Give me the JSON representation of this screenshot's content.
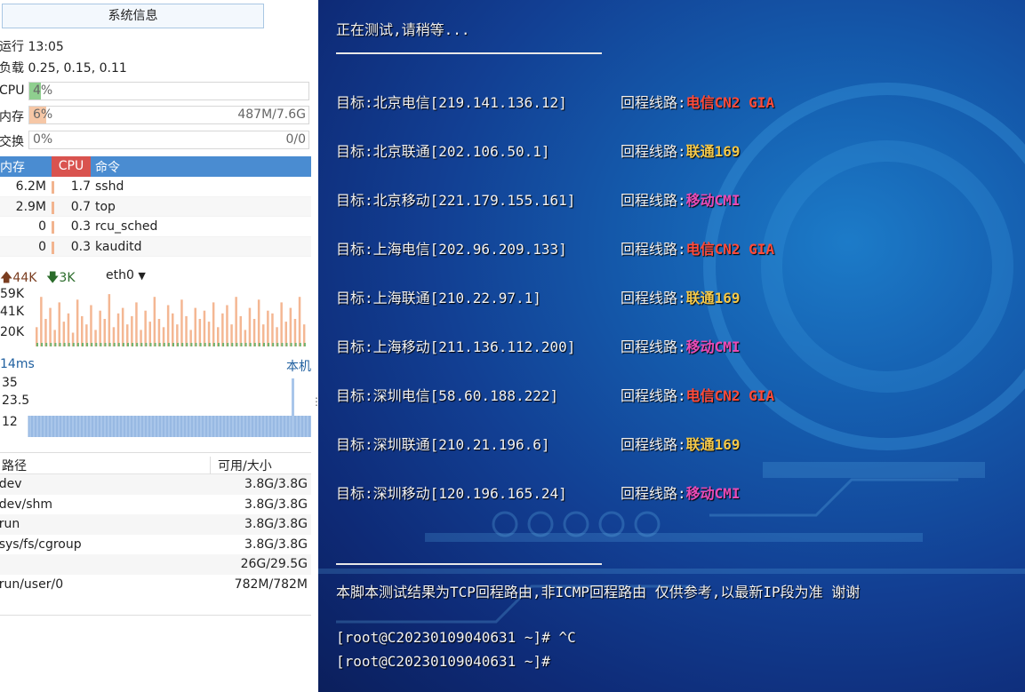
{
  "sysinfo": {
    "title_button": "系统信息",
    "uptime": "运行 13:05",
    "load": "负载 0.25, 0.15, 0.11",
    "cpu": {
      "label": "CPU",
      "percent_text": "4%",
      "value": 4,
      "color": "#8fcf8f"
    },
    "mem": {
      "label": "内存",
      "percent_text": "6%",
      "value": 6,
      "detail": "487M/7.6G",
      "color": "#f6c7a6"
    },
    "swap": {
      "label": "交换",
      "percent_text": "0%",
      "value": 0,
      "detail": "0/0"
    },
    "proc_headers": {
      "mem": "内存",
      "cpu": "CPU",
      "cmd": "命令"
    },
    "processes": [
      {
        "mem": "6.2M",
        "cpu": "1.7",
        "cmd": "sshd"
      },
      {
        "mem": "2.9M",
        "cpu": "0.7",
        "cmd": "top"
      },
      {
        "mem": "0",
        "cpu": "0.3",
        "cmd": "rcu_sched"
      },
      {
        "mem": "0",
        "cpu": "0.3",
        "cmd": "kauditd"
      }
    ],
    "network": {
      "up": "44K",
      "down": "3K",
      "interface": "eth0",
      "axis": [
        "59K",
        "41K",
        "20K"
      ],
      "up_color": "#f4b793",
      "down_color": "#6fb36f"
    },
    "ping": {
      "latency": "14ms",
      "target": "本机",
      "axis": [
        "35",
        "23.5",
        "12"
      ],
      "bar_color": "#a9c6ea"
    },
    "fs_headers": {
      "path": "路径",
      "avail": "可用/大小"
    },
    "filesystems": [
      {
        "path": "/dev",
        "avail": "3.8G/3.8G"
      },
      {
        "path": "/dev/shm",
        "avail": "3.8G/3.8G"
      },
      {
        "path": "/run",
        "avail": "3.8G/3.8G"
      },
      {
        "path": "/sys/fs/cgroup",
        "avail": "3.8G/3.8G"
      },
      {
        "path": "/",
        "avail": "26G/29.5G"
      },
      {
        "path": "/run/user/0",
        "avail": "782M/782M"
      }
    ]
  },
  "terminal": {
    "waiting": "正在测试,请稍等...",
    "rule_top": "______________________________",
    "colors": {
      "telecom": "#ff4b3a",
      "unicom": "#f3c84a",
      "mobile": "#e84bb5"
    },
    "results": [
      {
        "target": "目标:北京电信[219.141.136.12]",
        "route_label": "回程线路:",
        "route": "电信CN2 GIA",
        "kind": "telecom"
      },
      {
        "target": "目标:北京联通[202.106.50.1]",
        "route_label": "回程线路:",
        "route": "联通169",
        "kind": "unicom"
      },
      {
        "target": "目标:北京移动[221.179.155.161]",
        "route_label": "回程线路:",
        "route": "移动CMI",
        "kind": "mobile"
      },
      {
        "target": "目标:上海电信[202.96.209.133]",
        "route_label": "回程线路:",
        "route": "电信CN2 GIA",
        "kind": "telecom"
      },
      {
        "target": "目标:上海联通[210.22.97.1]",
        "route_label": "回程线路:",
        "route": "联通169",
        "kind": "unicom"
      },
      {
        "target": "目标:上海移动[211.136.112.200]",
        "route_label": "回程线路:",
        "route": "移动CMI",
        "kind": "mobile"
      },
      {
        "target": "目标:深圳电信[58.60.188.222]",
        "route_label": "回程线路:",
        "route": "电信CN2 GIA",
        "kind": "telecom"
      },
      {
        "target": "目标:深圳联通[210.21.196.6]",
        "route_label": "回程线路:",
        "route": "联通169",
        "kind": "unicom"
      },
      {
        "target": "目标:深圳移动[120.196.165.24]",
        "route_label": "回程线路:",
        "route": "移动CMI",
        "kind": "mobile"
      }
    ],
    "rule_bottom": "______________________________",
    "note": "本脚本测试结果为TCP回程路由,非ICMP回程路由 仅供参考,以最新IP段为准 谢谢",
    "prompt1": "[root@C20230109040631 ~]# ^C",
    "prompt2": "[root@C20230109040631 ~]#"
  }
}
